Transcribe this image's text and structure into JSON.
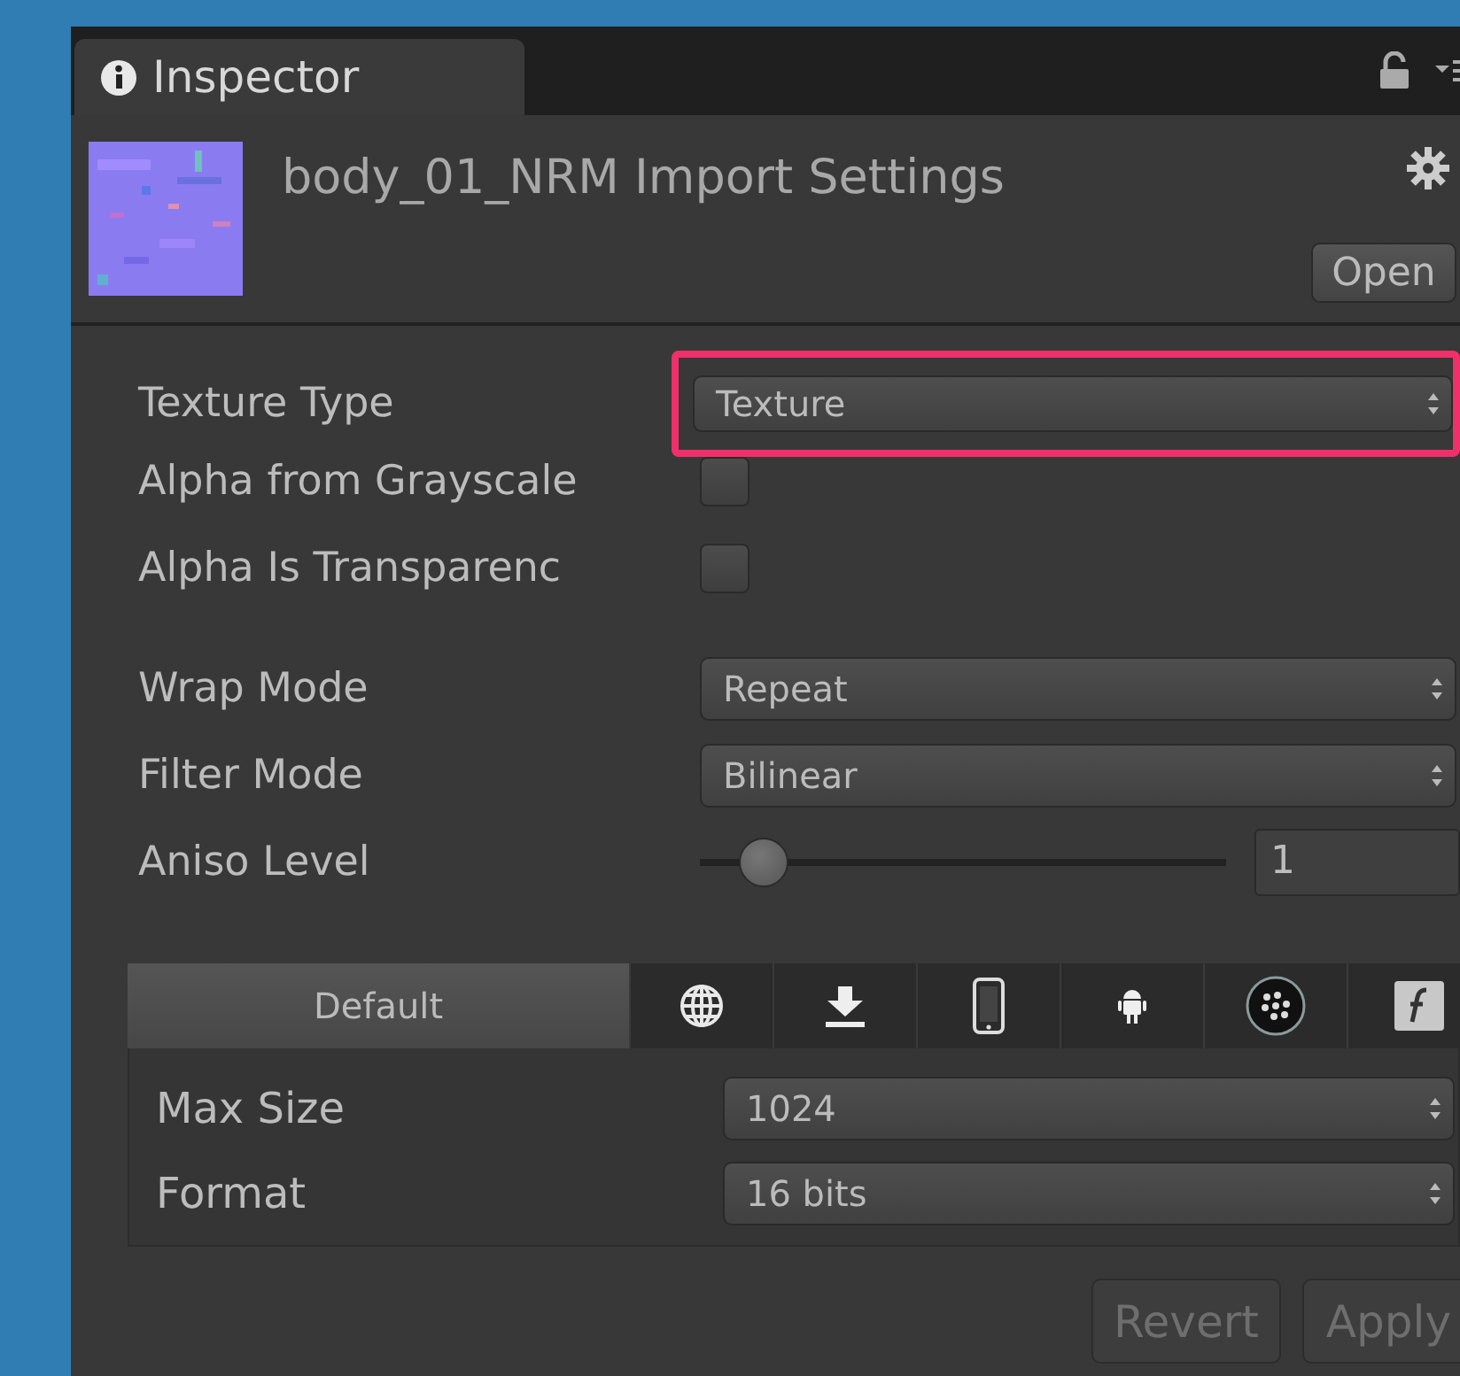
{
  "tab": {
    "label": "Inspector",
    "selected": true
  },
  "header": {
    "title": "body_01_NRM Import Settings",
    "open_button": "Open"
  },
  "property_groups": [
    [
      {
        "kind": "dropdown",
        "label": "Texture Type",
        "value": "Texture",
        "highlighted": true
      },
      {
        "kind": "checkbox",
        "label": "Alpha from Grayscale",
        "checked": false
      },
      {
        "kind": "checkbox",
        "label": "Alpha Is Transparenc",
        "checked": false
      }
    ],
    [
      {
        "kind": "dropdown",
        "label": "Wrap Mode",
        "value": "Repeat",
        "highlighted": false
      },
      {
        "kind": "dropdown",
        "label": "Filter Mode",
        "value": "Bilinear",
        "highlighted": false
      },
      {
        "kind": "slider",
        "label": "Aniso Level",
        "level": 0.12,
        "value": "1"
      }
    ]
  ],
  "platforms": [
    {
      "kind": "label",
      "label": "Default",
      "selected": true
    },
    {
      "kind": "globe",
      "selected": false
    },
    {
      "kind": "download",
      "selected": false
    },
    {
      "kind": "phone",
      "selected": false
    },
    {
      "kind": "robot",
      "selected": false
    },
    {
      "kind": "dots",
      "selected": false
    },
    {
      "kind": "tile",
      "selected": false
    }
  ],
  "platform_settings": [
    {
      "label": "Max Size",
      "value": "1024"
    },
    {
      "label": "Format",
      "value": "16 bits"
    }
  ],
  "buttons": [
    {
      "label": "Revert",
      "disabled": true
    },
    {
      "label": "Apply",
      "disabled": true
    }
  ]
}
